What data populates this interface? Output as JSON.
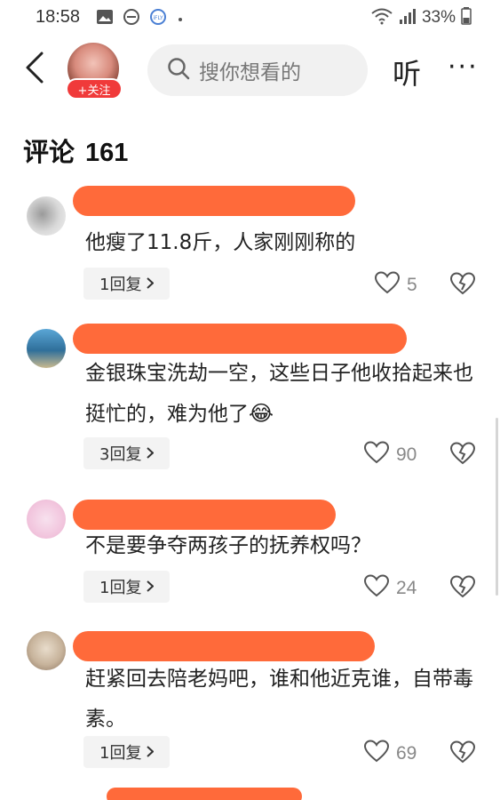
{
  "status_bar": {
    "time": "18:58",
    "battery": "33%",
    "icons": [
      "image-icon",
      "minus-circle-icon",
      "iflytek-icon",
      "dot-icon",
      "wifi-icon",
      "signal-icon",
      "battery-icon"
    ]
  },
  "nav": {
    "back_icon": "chevron-left-icon",
    "follow_label": "+关注",
    "search_placeholder": "搜你想看的",
    "listen_label": "听",
    "more_label": "···"
  },
  "comments": {
    "title": "评论",
    "count": "161",
    "items": [
      {
        "text": "他瘦了11.8斤，人家刚刚称的",
        "reply": "1回复",
        "likes": "5",
        "avatar_color": "#cfcfcf"
      },
      {
        "text": "金银珠宝洗劫一空，这些日子他收拾起来也挺忙的，难为他了",
        "emoji": "😂",
        "reply": "3回复",
        "likes": "90",
        "avatar_color": "#4e83a8"
      },
      {
        "text": "不是要争夺两孩子的抚养权吗？",
        "reply": "1回复",
        "likes": "24",
        "avatar_color": "#f3cfe4"
      },
      {
        "text": "赶紧回去陪老妈吧，谁和他近克谁，自带毒素。",
        "reply": "1回复",
        "likes": "69",
        "avatar_color": "#c7b39b"
      }
    ]
  },
  "colors": {
    "redaction": "#ff6a3a",
    "follow_badge": "#f03a3a",
    "search_bg": "#f1f1f1"
  }
}
